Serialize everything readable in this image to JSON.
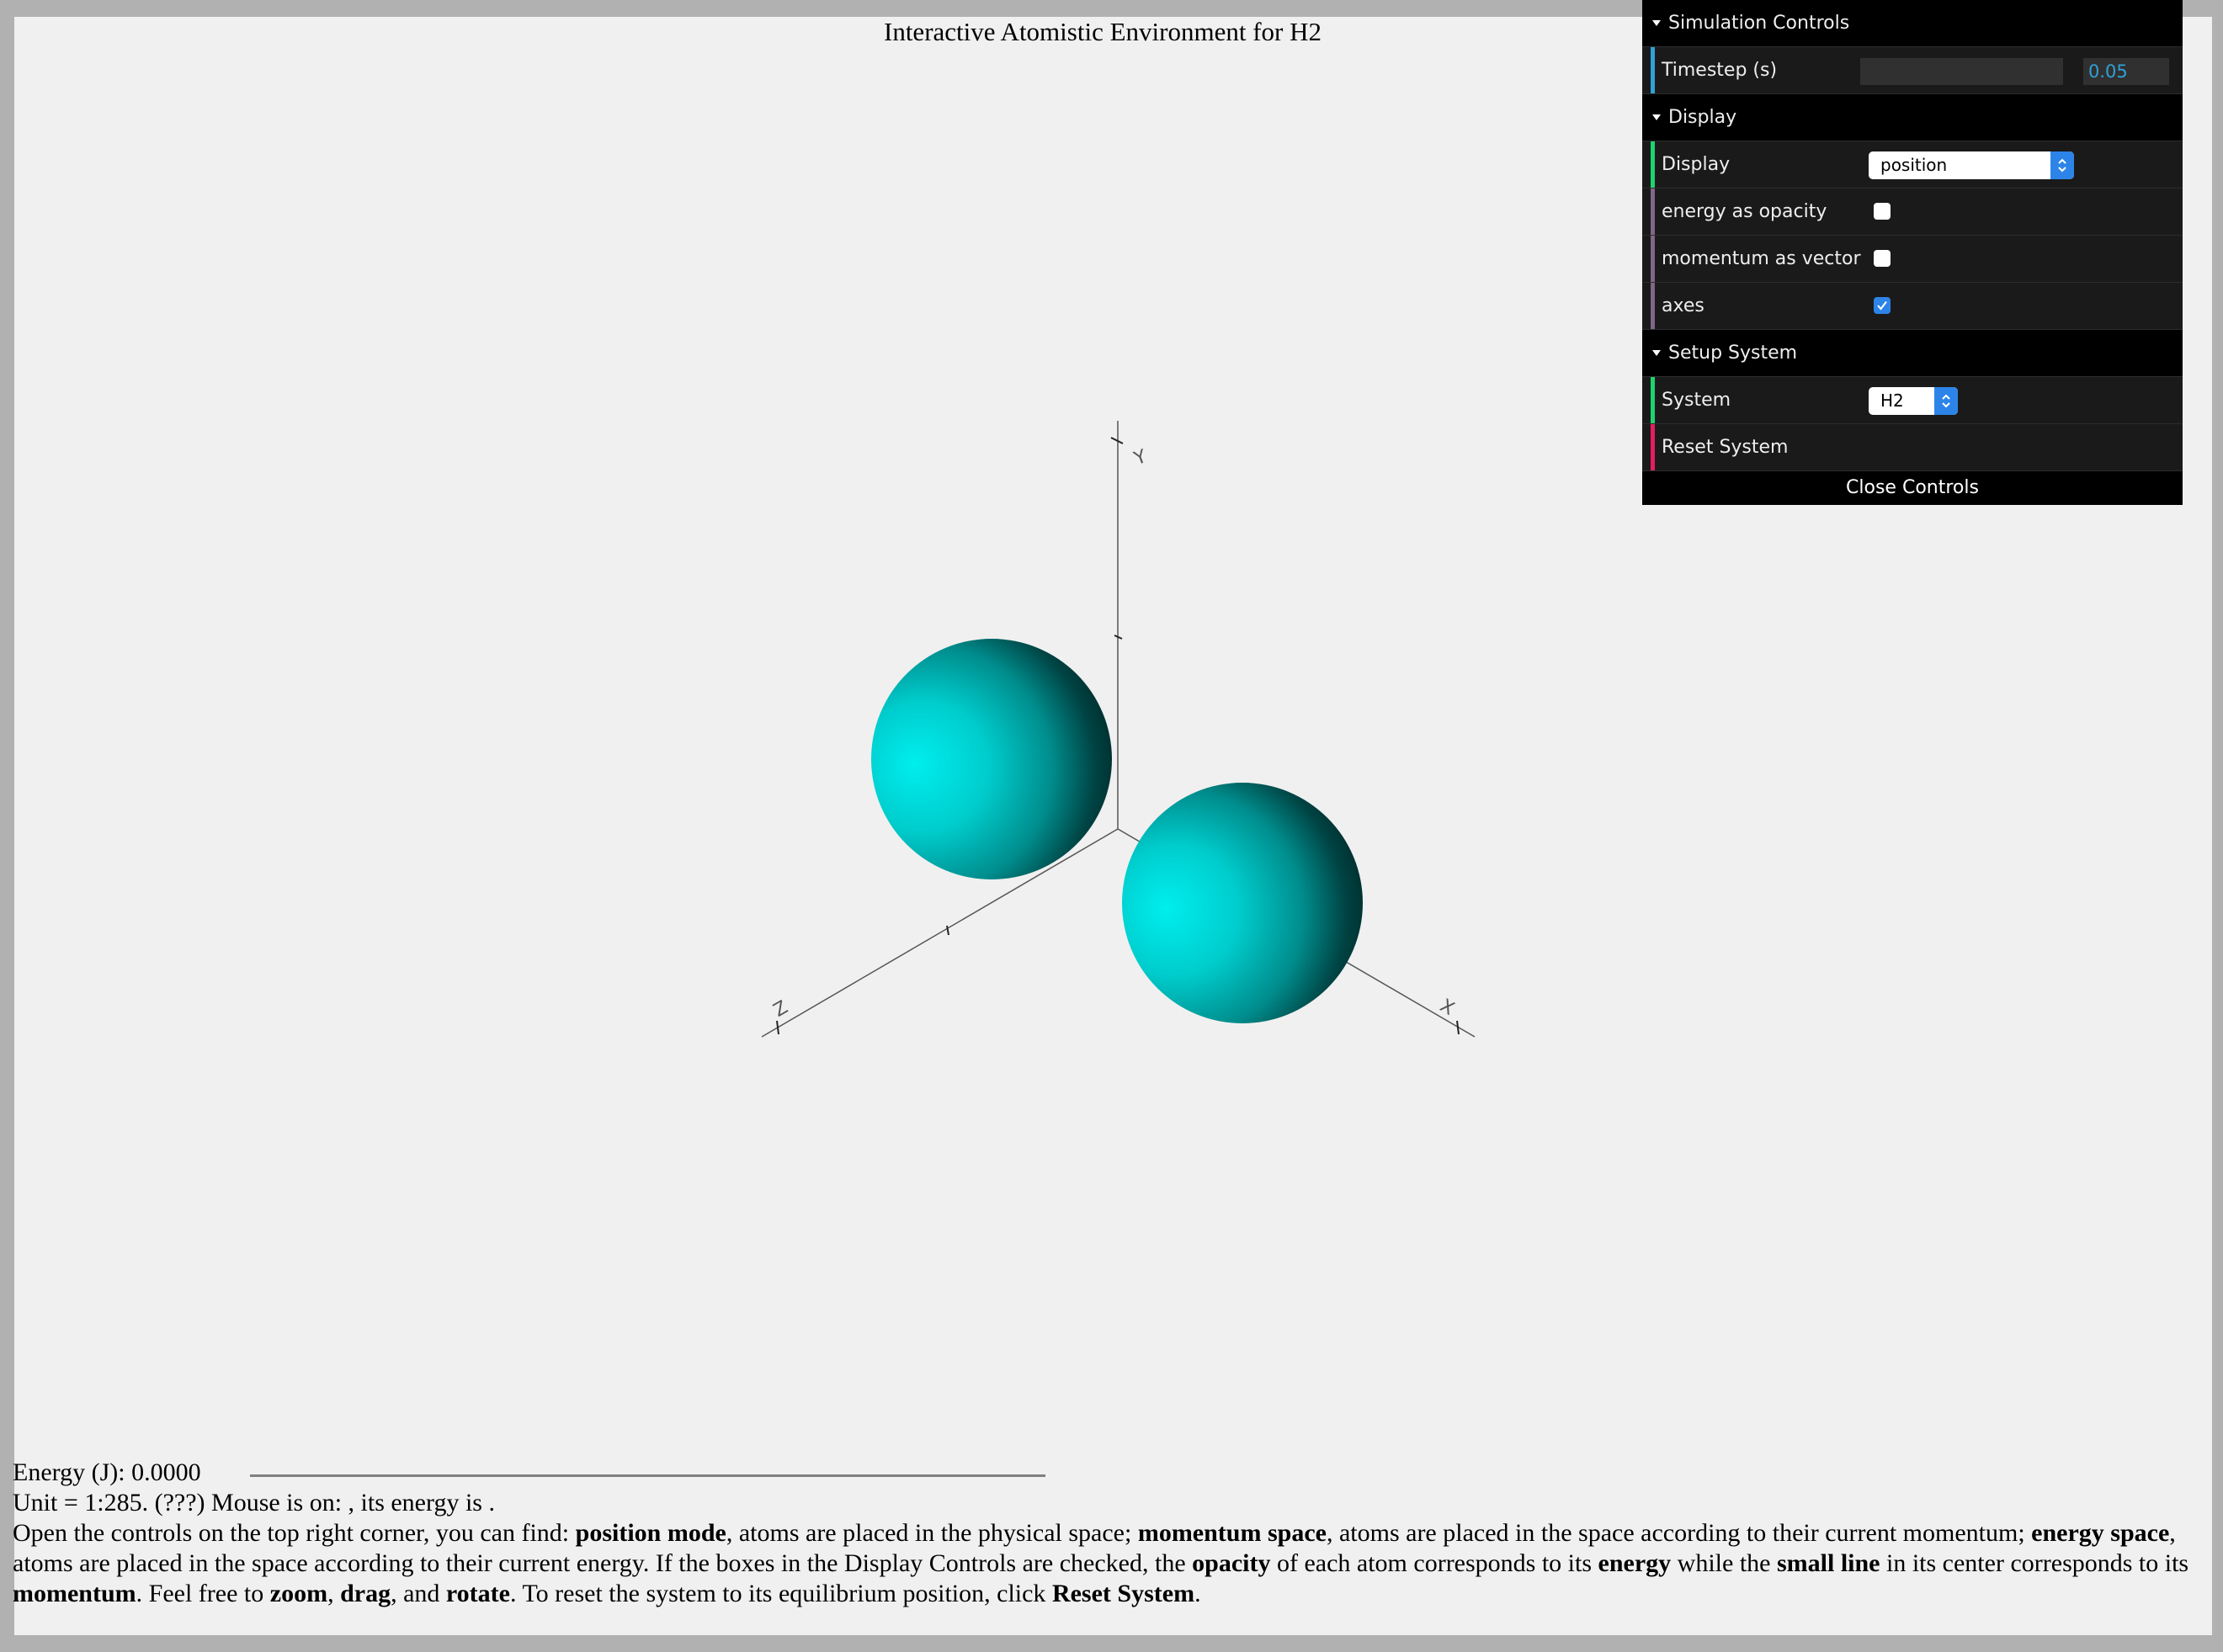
{
  "page": {
    "title": "Interactive Atomistic Environment for H2"
  },
  "scene": {
    "axis_labels": {
      "x": "X",
      "y": "Y",
      "z": "Z"
    },
    "atom_color": "#00e6e6",
    "atom_count": 2,
    "axes_visible": true
  },
  "controls": {
    "simulation": {
      "title": "Simulation Controls",
      "timestep_label": "Timestep (s)",
      "timestep_value": "0.05"
    },
    "display": {
      "title": "Display",
      "display_label": "Display",
      "display_value": "position",
      "energy_opacity_label": "energy as opacity",
      "energy_opacity_checked": false,
      "momentum_vector_label": "momentum as vector",
      "momentum_vector_checked": false,
      "axes_label": "axes",
      "axes_checked": true
    },
    "setup": {
      "title": "Setup System",
      "system_label": "System",
      "system_value": "H2",
      "reset_label": "Reset System"
    },
    "close_label": "Close Controls"
  },
  "info": {
    "energy_text": "Energy (J): 0.0000",
    "unit_text": "Unit = 1:285. (???) Mouse is on: , its energy is .",
    "instructions": [
      {
        "t": "Open the controls on the top right corner, you can find: ",
        "b": false
      },
      {
        "t": "position mode",
        "b": true
      },
      {
        "t": ", atoms are placed in the physical space; ",
        "b": false
      },
      {
        "t": "momentum space",
        "b": true
      },
      {
        "t": ", atoms are placed in the space according to their current momentum; ",
        "b": false
      },
      {
        "t": "energy space",
        "b": true
      },
      {
        "t": ", atoms are placed in the space according to their current energy. If the boxes in the Display Controls are checked, the ",
        "b": false
      },
      {
        "t": "opacity",
        "b": true
      },
      {
        "t": " of each atom corresponds to its ",
        "b": false
      },
      {
        "t": "energy",
        "b": true
      },
      {
        "t": " while the ",
        "b": false
      },
      {
        "t": "small line",
        "b": true
      },
      {
        "t": " in its center corresponds to its ",
        "b": false
      },
      {
        "t": "momentum",
        "b": true
      },
      {
        "t": ". Feel free to ",
        "b": false
      },
      {
        "t": "zoom",
        "b": true
      },
      {
        "t": ", ",
        "b": false
      },
      {
        "t": "drag",
        "b": true
      },
      {
        "t": ", and ",
        "b": false
      },
      {
        "t": "rotate",
        "b": true
      },
      {
        "t": ". To reset the system to its equilibrium position, click ",
        "b": false
      },
      {
        "t": "Reset System",
        "b": true
      },
      {
        "t": ".",
        "b": false
      }
    ]
  }
}
